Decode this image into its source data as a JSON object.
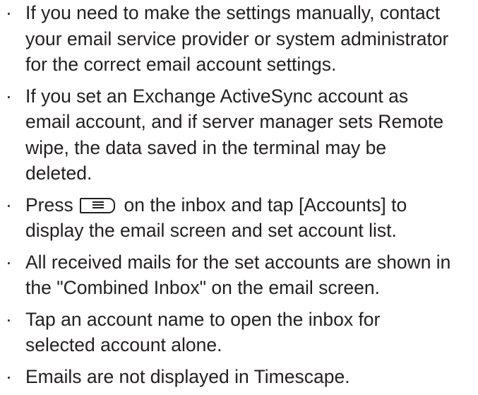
{
  "bullet_char": "·",
  "notes": [
    {
      "lines": [
        "If you need to make the settings manually, contact",
        "your email service provider or system administrator",
        "for the correct email account settings."
      ]
    },
    {
      "lines": [
        "If you set an Exchange ActiveSync account as",
        "email account, and if server manager sets Remote",
        "wipe, the data saved in the terminal may be",
        "deleted."
      ]
    },
    {
      "line1_before_icon": "Press",
      "line1_icon": "menu-key-icon",
      "line1_after_icon": "on the inbox and tap [Accounts] to",
      "line2": "display the email screen and set account list."
    },
    {
      "lines": [
        "All received mails for the set accounts are shown in",
        "the \"Combined Inbox\" on the email screen."
      ]
    },
    {
      "lines": [
        "Tap an account name to open the inbox for",
        "selected account alone."
      ]
    },
    {
      "lines": [
        "Emails are not displayed in Timescape."
      ]
    }
  ]
}
